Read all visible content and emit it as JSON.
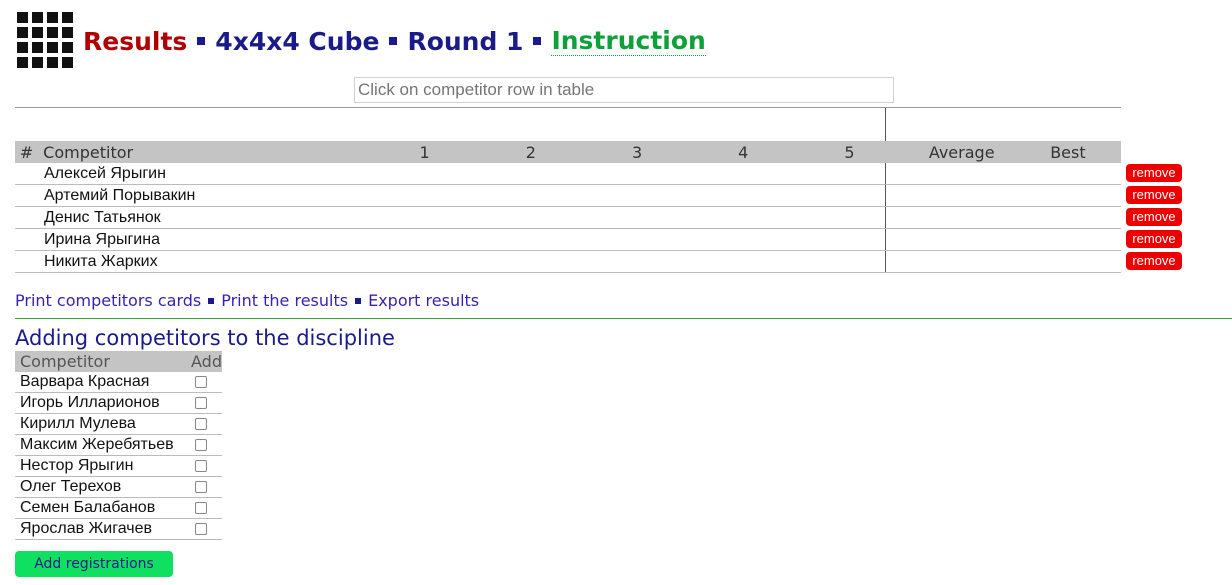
{
  "header": {
    "logo_icon": "grid-logo-icon",
    "results": "Results",
    "discipline": "4x4x4 Cube",
    "round": "Round 1",
    "instruction": "Instruction",
    "colors": {
      "results": "#b00000",
      "navy": "#1a1a8a",
      "instruction": "#0ea13a"
    }
  },
  "search": {
    "placeholder": "Click on competitor row in table"
  },
  "results_table": {
    "headers": {
      "num": "#",
      "competitor": "Competitor",
      "a1": "1",
      "a2": "2",
      "a3": "3",
      "a4": "4",
      "a5": "5",
      "average": "Average",
      "best": "Best"
    },
    "rows": [
      {
        "name": "Алексей Ярыгин",
        "action": "remove"
      },
      {
        "name": "Артемий Порывакин",
        "action": "remove"
      },
      {
        "name": "Денис Татьянок",
        "action": "remove"
      },
      {
        "name": "Ирина Ярыгина",
        "action": "remove"
      },
      {
        "name": "Никита Жарких",
        "action": "remove"
      }
    ]
  },
  "links": {
    "print_cards": "Print competitors cards",
    "print_results": "Print the results",
    "export": "Export results"
  },
  "adding": {
    "title": "Adding competitors to the discipline",
    "headers": {
      "competitor": "Competitor",
      "add": "Add"
    },
    "rows": [
      {
        "name": "Варвара Красная"
      },
      {
        "name": "Игорь Илларионов"
      },
      {
        "name": "Кирилл Мулева"
      },
      {
        "name": "Максим Жеребятьев"
      },
      {
        "name": "Нестор Ярыгин"
      },
      {
        "name": "Олег Терехов"
      },
      {
        "name": "Семен Балабанов"
      },
      {
        "name": "Ярослав Жигачев"
      }
    ],
    "button": "Add registrations",
    "button_color": "#10e060"
  }
}
